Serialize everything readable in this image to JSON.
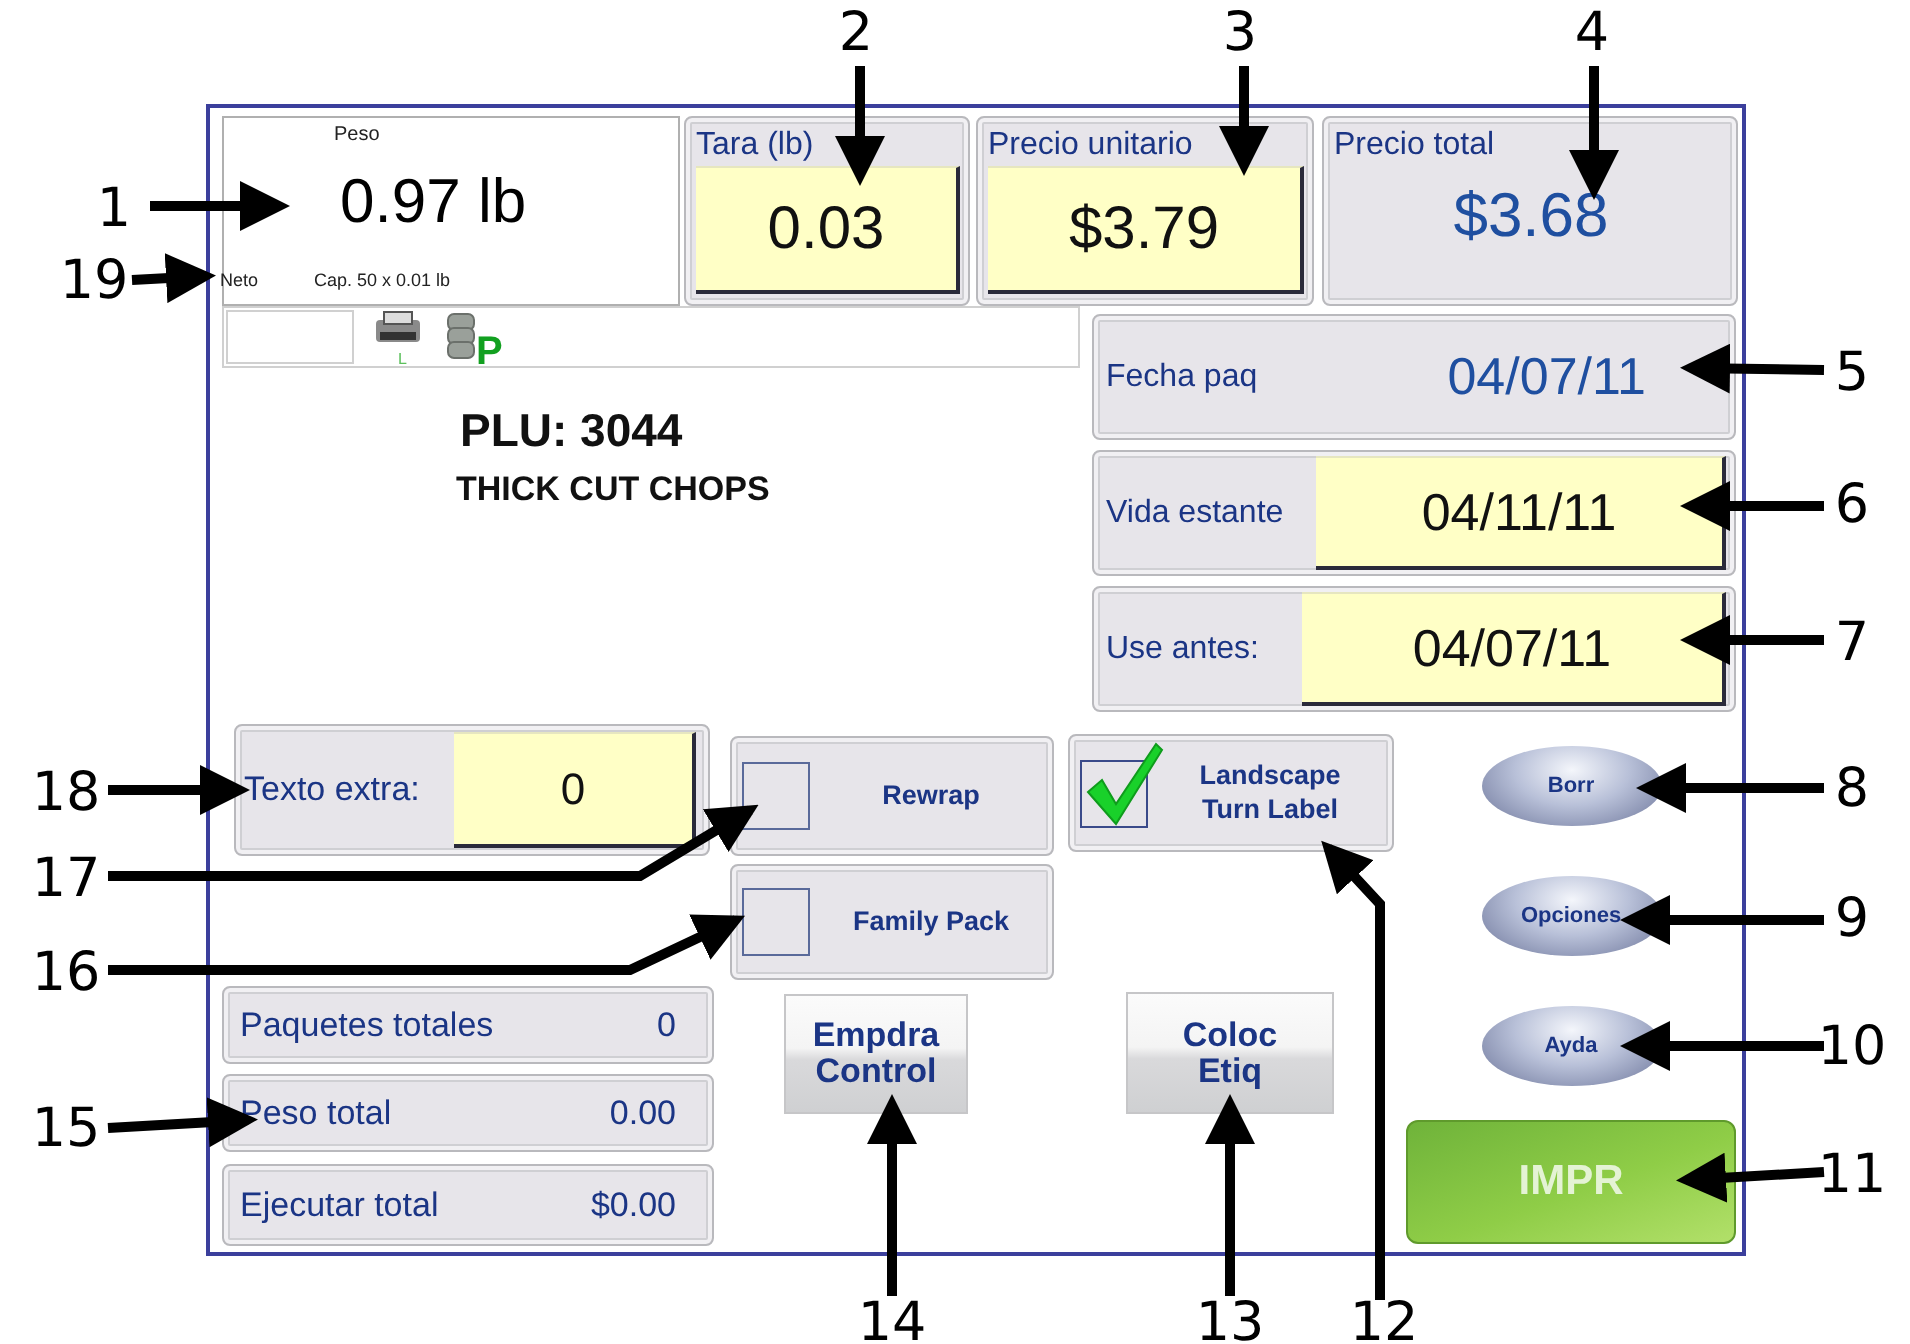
{
  "weight_display": {
    "caption": "Peso",
    "value": "0.97 lb",
    "mode": "Neto",
    "capacity": "Cap. 50 x 0.01 lb"
  },
  "price_fields": [
    {
      "kind": "input",
      "label": "Tara (lb)",
      "value": "0.03"
    },
    {
      "kind": "input",
      "label": "Precio unitario",
      "value": "$3.79"
    },
    {
      "kind": "display",
      "label": "Precio total",
      "value": "$3.68"
    }
  ],
  "status_icons": [
    {
      "kind": "printer",
      "badge": "L"
    },
    {
      "kind": "database",
      "badge": "P"
    }
  ],
  "product": {
    "plu": "PLU: 3044",
    "name": "THICK CUT CHOPS"
  },
  "dates": [
    {
      "kind": "display",
      "label": "Fecha paq",
      "value": "04/07/11"
    },
    {
      "kind": "input",
      "label": "Vida estante",
      "value": "04/11/11"
    },
    {
      "kind": "input",
      "label": "Use antes:",
      "value": "04/07/11"
    }
  ],
  "extra_text": {
    "label": "Texto extra:",
    "value": "0"
  },
  "options": [
    {
      "label": "Rewrap",
      "checked": false
    },
    {
      "label": "Family Pack",
      "checked": false
    },
    {
      "label": "Landscape\nTurn Label",
      "checked": true
    }
  ],
  "totals": [
    {
      "label": "Paquetes totales",
      "value": "0"
    },
    {
      "label": "Peso total",
      "value": "0.00"
    },
    {
      "label": "Ejecutar total",
      "value": "$0.00"
    }
  ],
  "action_buttons": [
    {
      "label": "Empdra\nControl"
    },
    {
      "label": "Coloc\nEtiq"
    }
  ],
  "side_buttons": [
    {
      "label": "Borr"
    },
    {
      "label": "Opciones"
    },
    {
      "label": "Ayda"
    }
  ],
  "print_button": {
    "label": "IMPR"
  },
  "callouts": [
    {
      "label": "2"
    },
    {
      "label": "3"
    },
    {
      "label": "4"
    },
    {
      "label": "1"
    },
    {
      "label": "19"
    },
    {
      "label": "5"
    },
    {
      "label": "6"
    },
    {
      "label": "7"
    },
    {
      "label": "18"
    },
    {
      "label": "8"
    },
    {
      "label": "17"
    },
    {
      "label": "9"
    },
    {
      "label": "16"
    },
    {
      "label": "10"
    },
    {
      "label": "15"
    },
    {
      "label": "11"
    },
    {
      "label": "14"
    },
    {
      "label": "13"
    },
    {
      "label": "12"
    }
  ]
}
